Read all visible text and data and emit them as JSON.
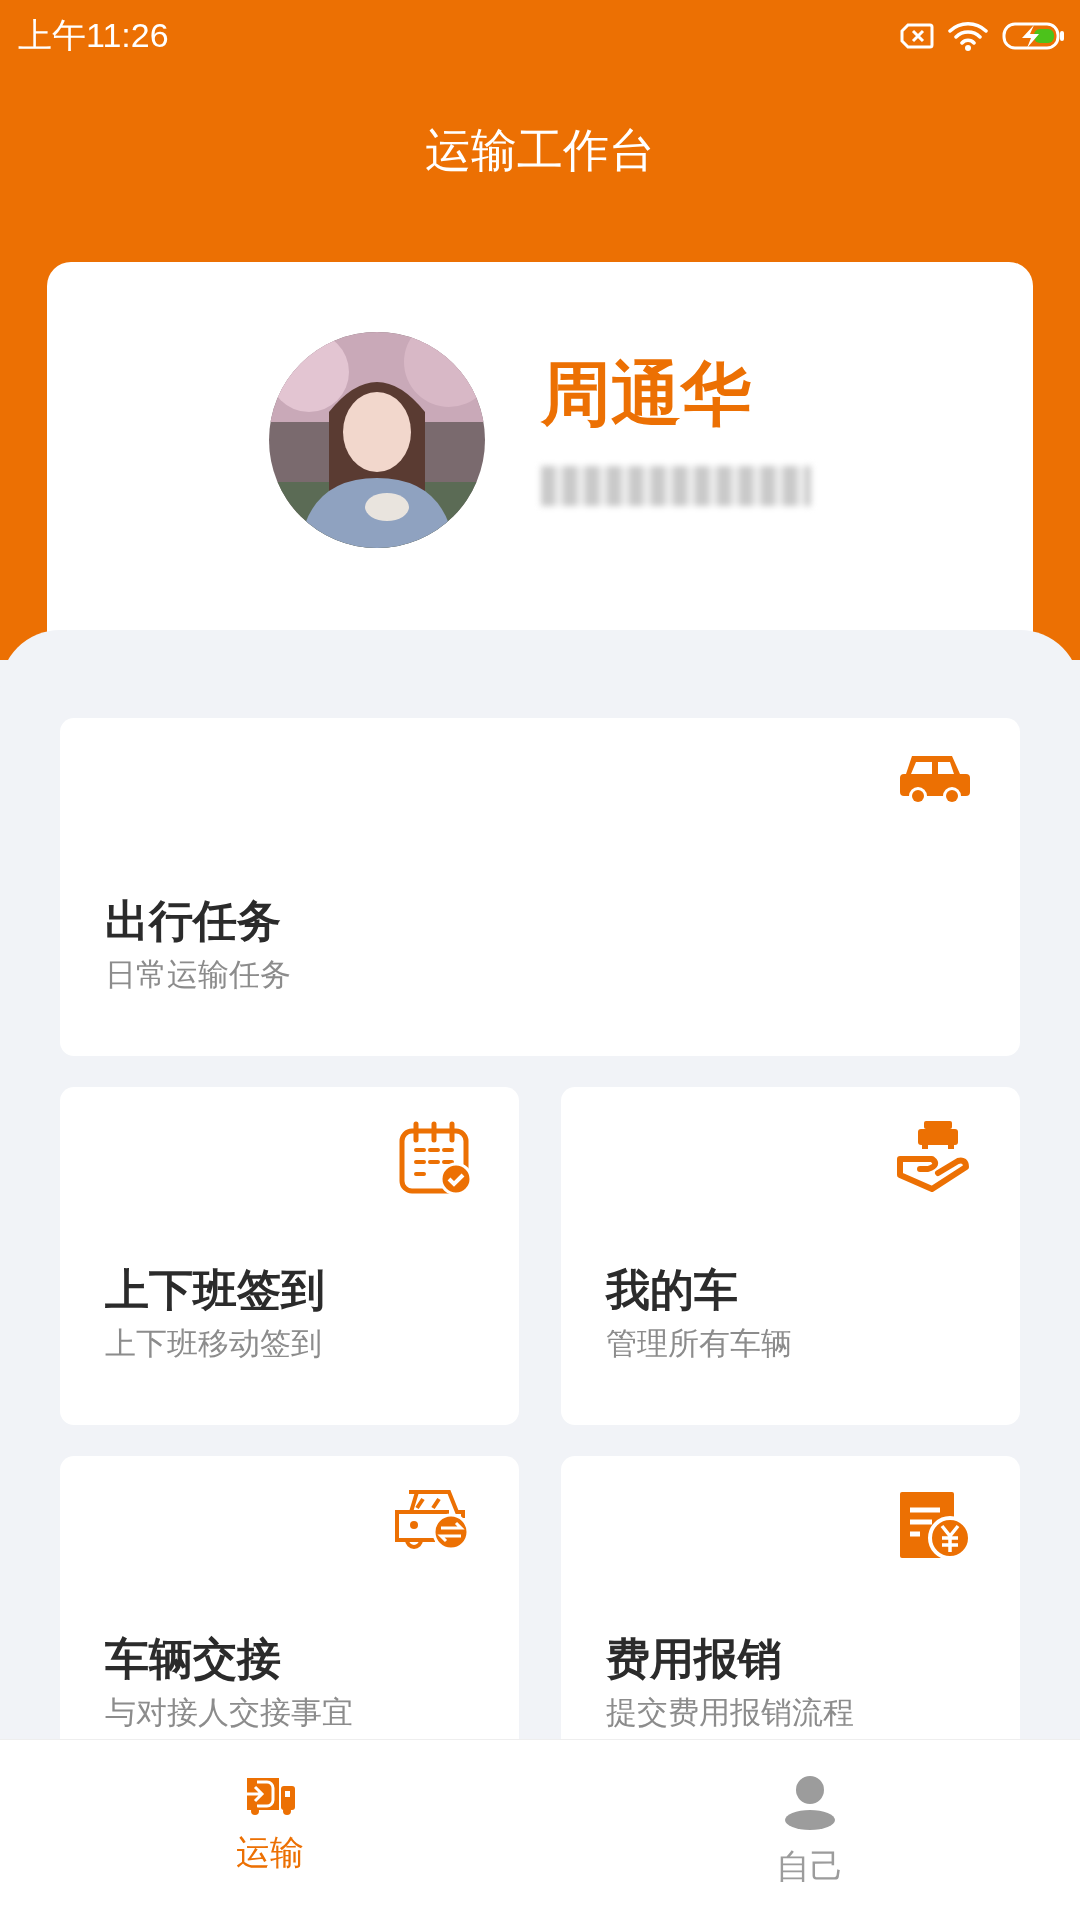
{
  "status_bar": {
    "time": "上午11:26"
  },
  "header": {
    "title": "运输工作台"
  },
  "profile": {
    "name": "周通华"
  },
  "tiles": [
    {
      "title": "出行任务",
      "subtitle": "日常运输任务",
      "wide": true
    },
    {
      "title": "上下班签到",
      "subtitle": "上下班移动签到",
      "wide": false
    },
    {
      "title": "我的车",
      "subtitle": "管理所有车辆",
      "wide": false
    },
    {
      "title": "车辆交接",
      "subtitle": "与对接人交接事宜",
      "wide": false
    },
    {
      "title": "费用报销",
      "subtitle": "提交费用报销流程",
      "wide": false
    }
  ],
  "nav": [
    {
      "label": "运输",
      "selected": true
    },
    {
      "label": "自己",
      "selected": false
    }
  ]
}
